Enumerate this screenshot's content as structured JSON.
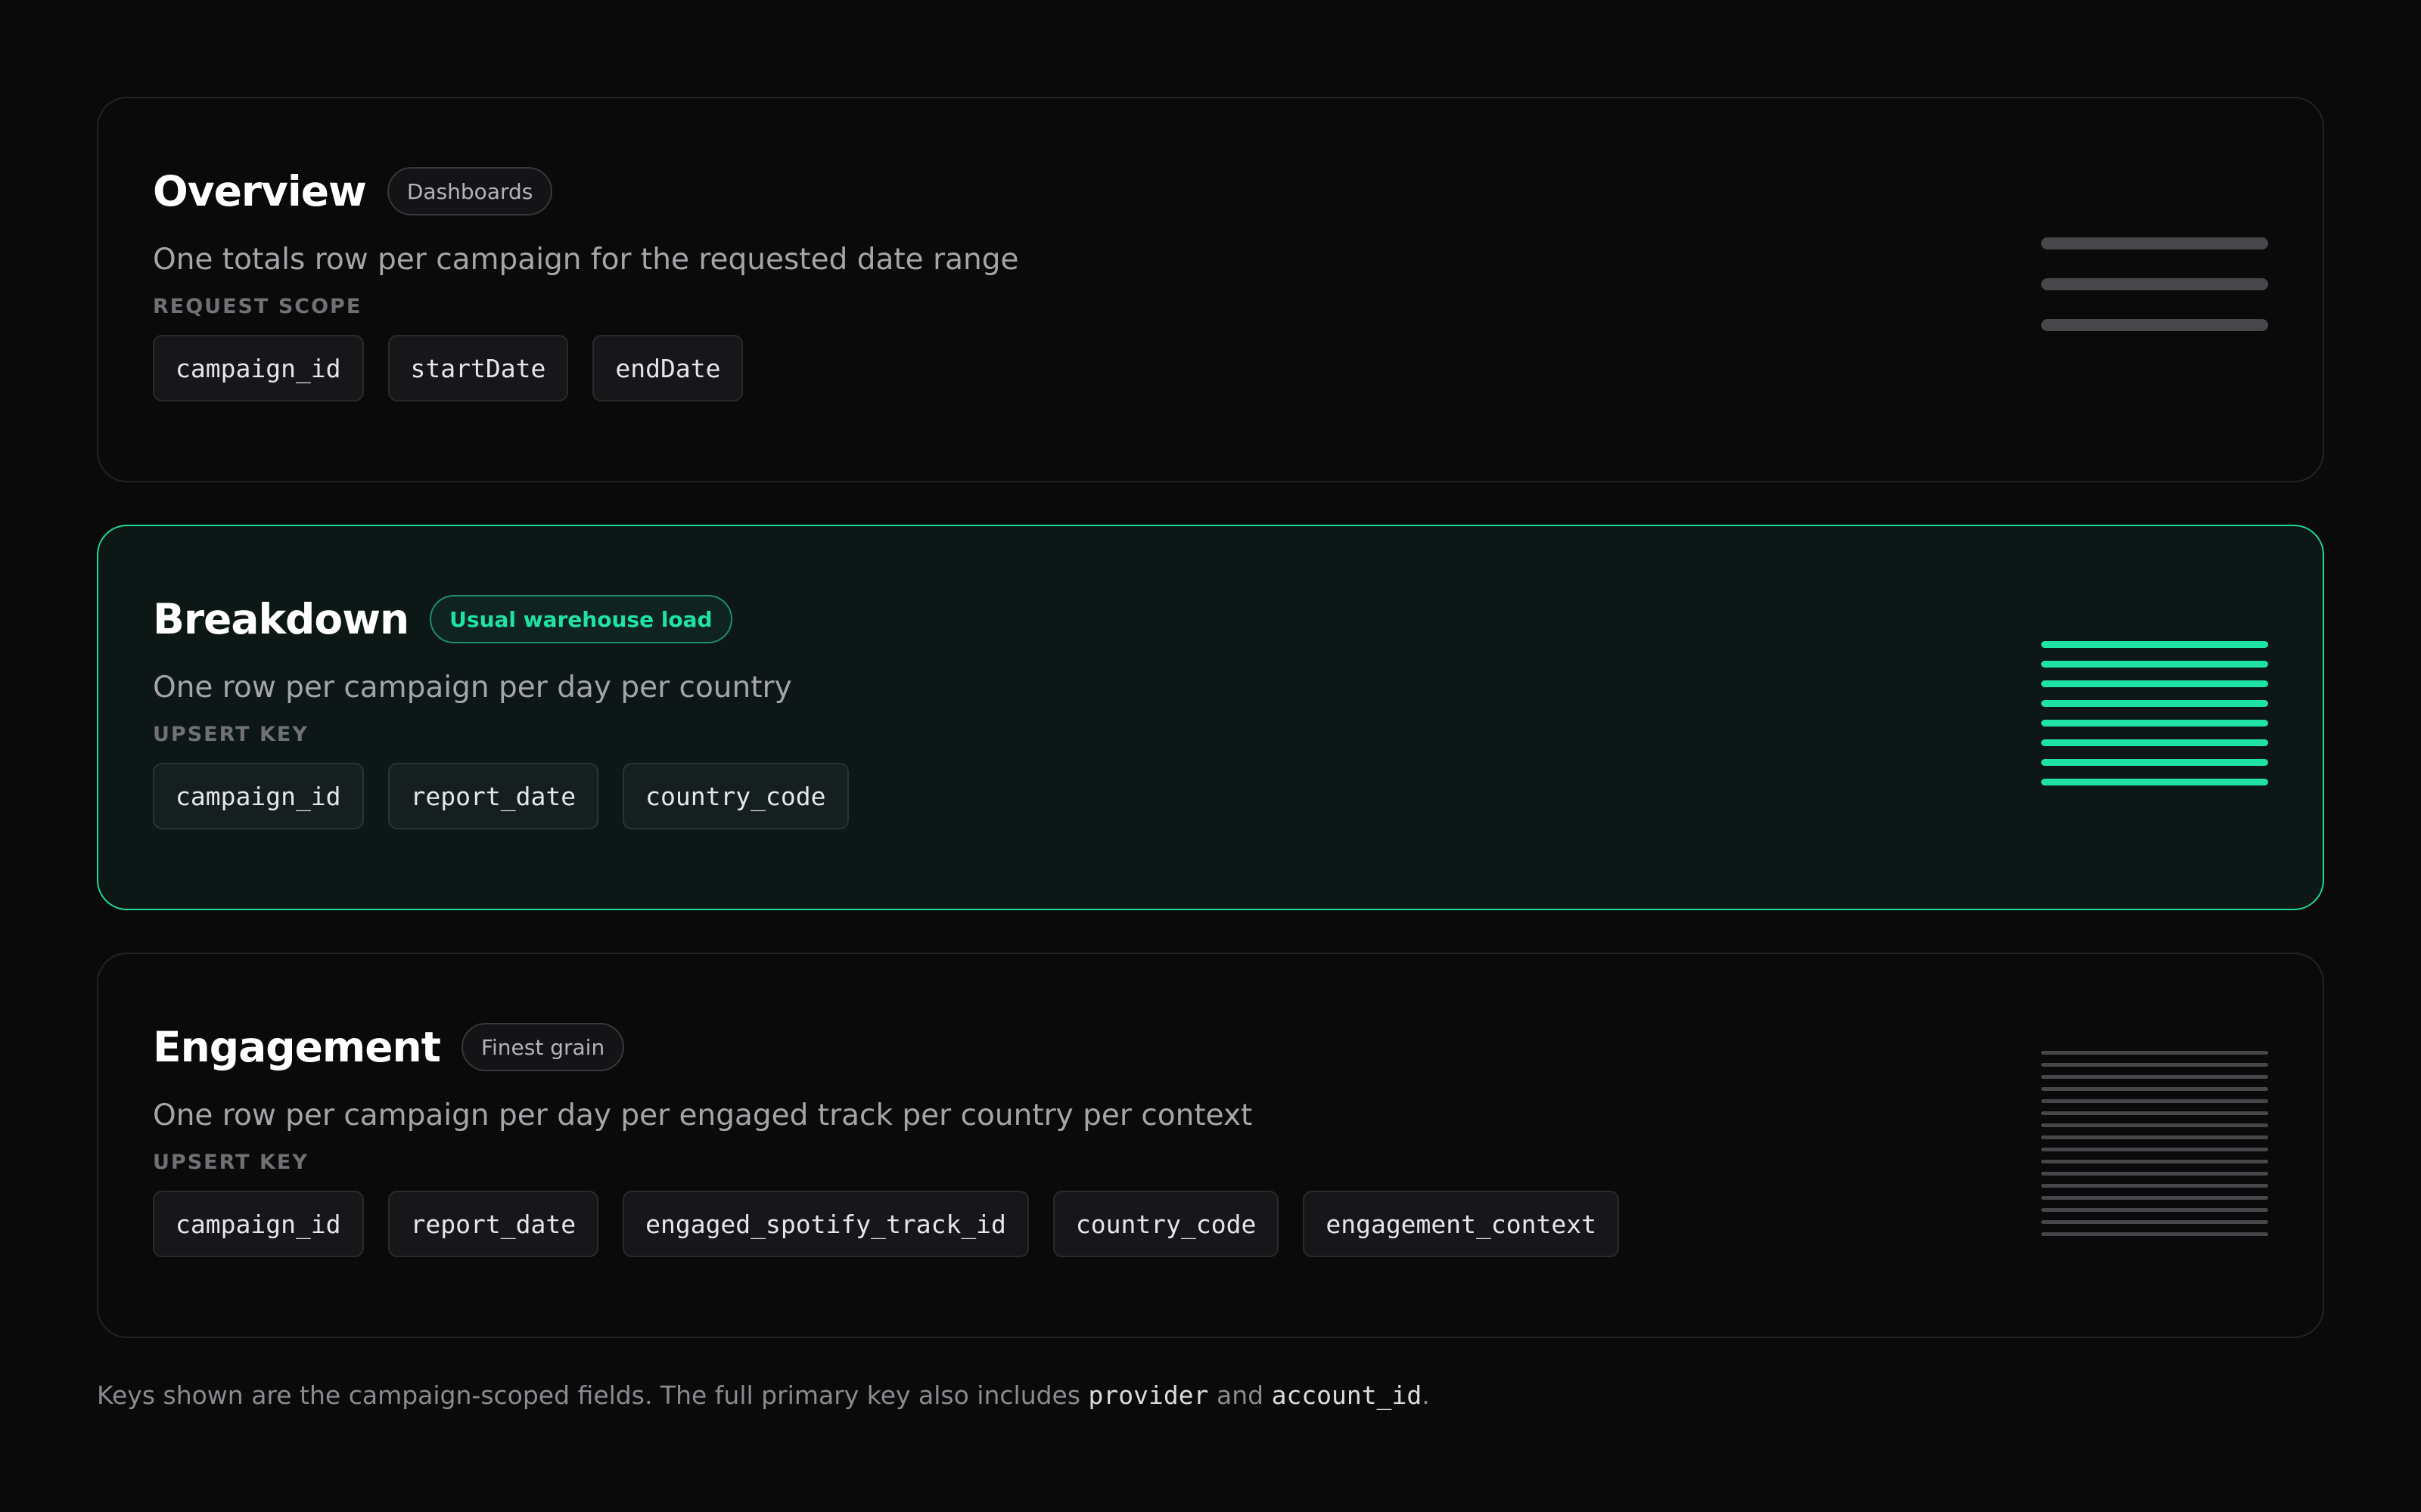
{
  "cards": [
    {
      "title": "Overview",
      "tag": "Dashboards",
      "description": "One totals row per campaign for the requested date range",
      "label": "REQUEST SCOPE",
      "fields": [
        "campaign_id",
        "startDate",
        "endDate"
      ],
      "bar_count": 3,
      "bar_color": "#46464b"
    },
    {
      "title": "Breakdown",
      "tag": "Usual warehouse load",
      "description": "One row per campaign per day per country",
      "label": "UPSERT KEY",
      "fields": [
        "campaign_id",
        "report_date",
        "country_code"
      ],
      "bar_count": 8,
      "bar_color": "#1fe3a4"
    },
    {
      "title": "Engagement",
      "tag": "Finest grain",
      "description": "One row per campaign per day per engaged track per country per context",
      "label": "UPSERT KEY",
      "fields": [
        "campaign_id",
        "report_date",
        "engaged_spotify_track_id",
        "country_code",
        "engagement_context"
      ],
      "bar_count": 16,
      "bar_color": "#46464b"
    }
  ],
  "footnote": {
    "text_before": "Keys shown are the campaign-scoped fields. The full primary key also includes ",
    "code1": "provider",
    "text_middle": " and ",
    "code2": "account_id",
    "text_after": "."
  },
  "colors": {
    "accent": "#1fe3a4",
    "background": "#0a0a0b"
  }
}
